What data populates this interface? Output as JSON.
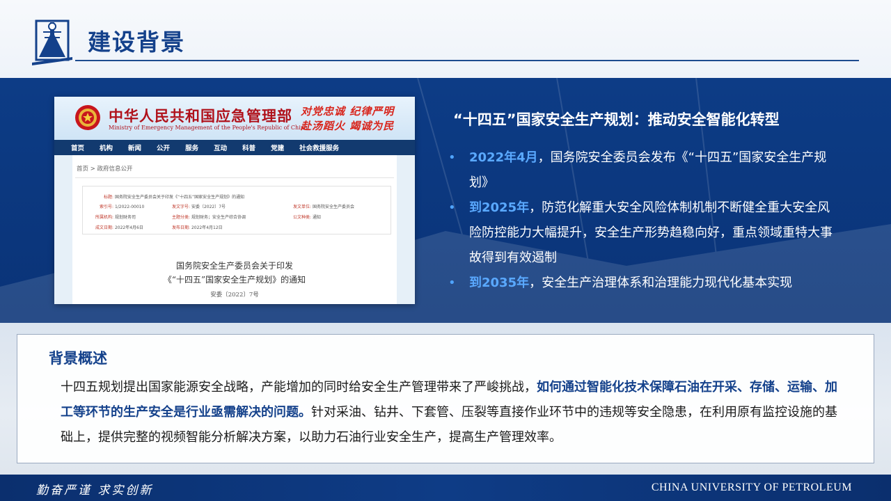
{
  "header": {
    "title": "建设背景"
  },
  "screenshot": {
    "site_name": "中华人民共和国应急管理部",
    "site_name_en": "Ministry of Emergency Management of the People's Republic of China",
    "slogan_line1": "对党忠诚 纪律严明",
    "slogan_line2": "赴汤蹈火 竭诚为民",
    "nav": [
      "首页",
      "机构",
      "新闻",
      "公开",
      "服务",
      "互动",
      "科普",
      "党建",
      "社会救援服务"
    ],
    "breadcrumb": "首页  >  政府信息公开",
    "meta": {
      "title_key": "标题:",
      "title_val": "国务院安全生产委员会关于印发《“十四五”国家安全生产规划》的通知",
      "index_key": "索引号:",
      "index_val": "1/2022-00010",
      "docno_key": "发文字号:",
      "docno_val": "安委〔2022〕7号",
      "issuer_key": "发文单位:",
      "issuer_val": "国务院安全生产委员会",
      "org_key": "所属机构:",
      "org_val": "规划财务司",
      "topic_key": "主题分类:",
      "topic_val": "规划财务；安全生产综合协调",
      "open_key": "公文种类:",
      "open_val": "通知",
      "date_key": "成文日期:",
      "date_val": "2022年4月6日",
      "pub_key": "发布日期:",
      "pub_val": "2022年4月12日"
    },
    "notice_line1": "国务院安全生产委员会关于印发",
    "notice_line2": "《“十四五”国家安全生产规划》的通知",
    "notice_line3": "安委〔2022〕7号"
  },
  "plan": {
    "title": "“十四五”国家安全生产规划：推动安全智能化转型",
    "bullets": [
      {
        "highlight": "2022年4月",
        "text": "，国务院安全委员会发布《“十四五”国家安全生产规划》"
      },
      {
        "highlight": "到2025年",
        "text": "，防范化解重大安全风险体制机制不断健全重大安全风险防控能力大幅提升，安全生产形势趋稳向好，重点领域重特大事故得到有效遏制"
      },
      {
        "highlight": "到2035年",
        "text": "，安全生产治理体系和治理能力现代化基本实现"
      }
    ]
  },
  "overview": {
    "title": "背景概述",
    "text_before": "十四五规划提出国家能源安全战略，产能增加的同时给安全生产管理带来了严峻挑战，",
    "text_emphasis": "如何通过智能化技术保障石油在开采、存储、运输、加工等环节的生产安全是行业亟需解决的问题。",
    "text_after": "针对采油、钻井、下套管、压裂等直接作业环节中的违规等安全隐患，在利用原有监控设施的基础上，提供完整的视频智能分析解决方案，以助力石油行业安全生产，提高生产管理效率。"
  },
  "footer": {
    "motto": "勤奋严谨 求实创新",
    "university": "CHINA UNIVERSITY OF PETROLEUM"
  },
  "colors": {
    "brand_blue": "#14418b",
    "band_blue": "#0d3c86",
    "highlight_blue": "#5aa9ff"
  }
}
